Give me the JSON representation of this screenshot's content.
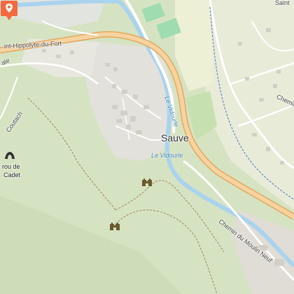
{
  "map": {
    "place_name": "Sauve",
    "river_label_1": "Le Vidourle",
    "river_label_2": "Le Vidourle",
    "road_label_top": "int-Hippolyte-du-Fort",
    "road_label_moulin": "Chemin du Moulin Neuf",
    "road_label_right": "Chemin",
    "road_label_left_1": "ale",
    "road_label_left_2": "Coutach",
    "poi_cave_line1": "rou de",
    "poi_cave_line2": "Cadet",
    "road_label_topright": "Saint"
  },
  "icons": {
    "location_marker": "map-pin-icon",
    "cave": "cave-icon",
    "castle_1": "castle-ruin-icon",
    "castle_2": "castle-ruin-icon"
  },
  "colors": {
    "forest": "#d6e3c2",
    "urban": "#e3e1dc",
    "main_road": "#f5c98b",
    "river": "#a9d3ee",
    "marker": "#f26a3d",
    "sport_field": "#9fdcb0"
  }
}
